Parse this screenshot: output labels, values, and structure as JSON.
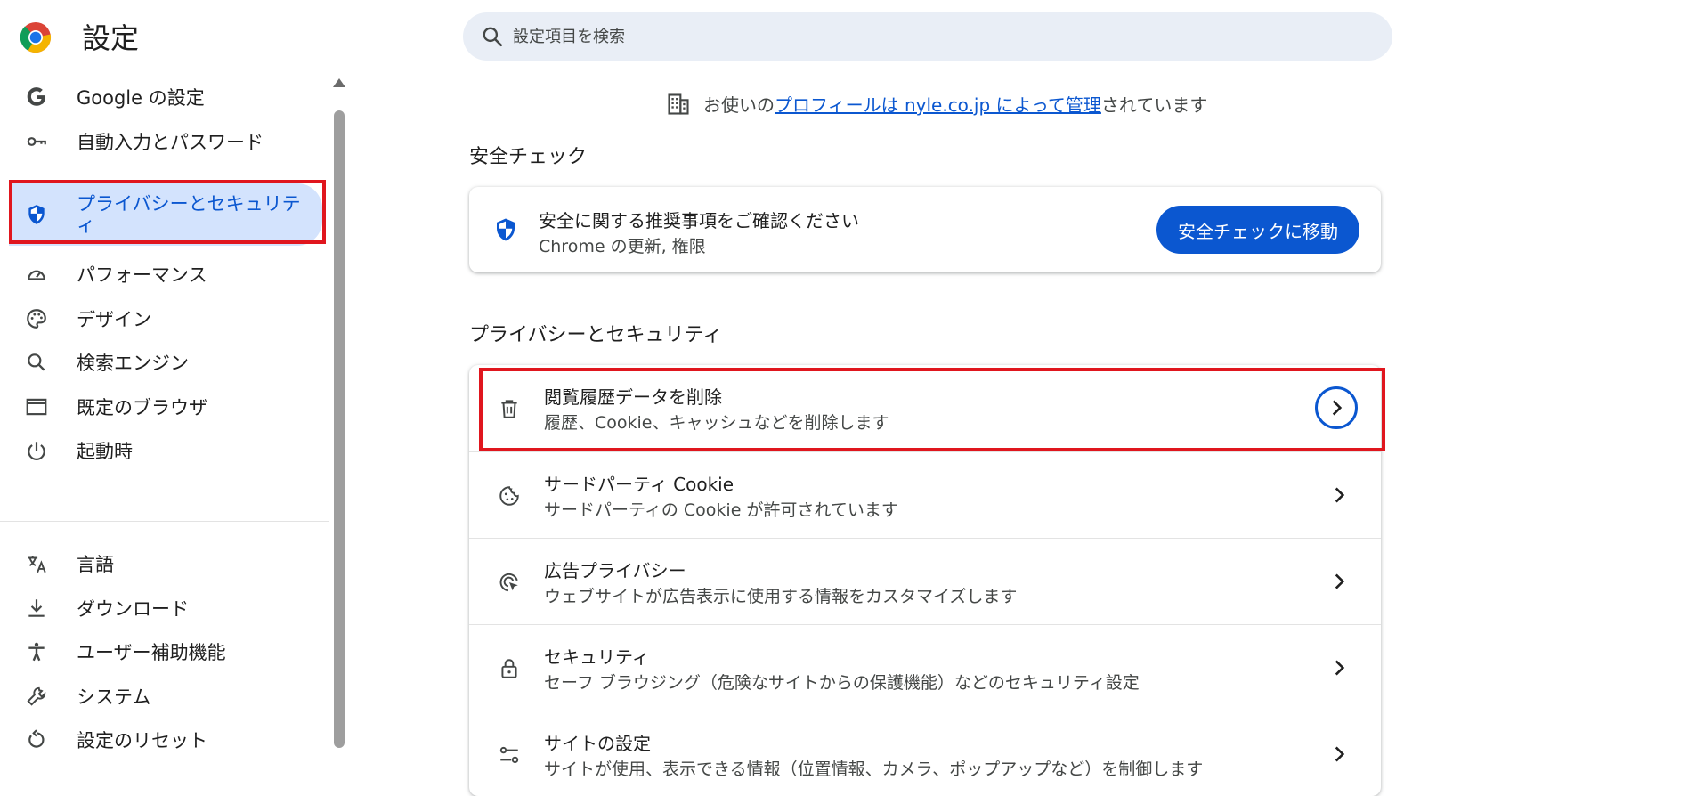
{
  "header": {
    "title": "設定",
    "search_placeholder": "設定項目を検索"
  },
  "sidebar": {
    "items": [
      {
        "label": "Google の設定",
        "icon": "google-g-icon"
      },
      {
        "label": "自動入力とパスワード",
        "icon": "key-icon"
      },
      {
        "label": "プライバシーとセキュリティ",
        "icon": "shield-icon",
        "active": true
      },
      {
        "label": "パフォーマンス",
        "icon": "speedometer-icon"
      },
      {
        "label": "デザイン",
        "icon": "palette-icon"
      },
      {
        "label": "検索エンジン",
        "icon": "search-icon"
      },
      {
        "label": "既定のブラウザ",
        "icon": "browser-window-icon"
      },
      {
        "label": "起動時",
        "icon": "power-icon"
      },
      {
        "label": "言語",
        "icon": "translate-icon"
      },
      {
        "label": "ダウンロード",
        "icon": "download-icon"
      },
      {
        "label": "ユーザー補助機能",
        "icon": "accessibility-icon"
      },
      {
        "label": "システム",
        "icon": "wrench-icon"
      },
      {
        "label": "設定のリセット",
        "icon": "reset-icon"
      }
    ]
  },
  "managed_notice": {
    "prefix": "お使いの",
    "link": "プロフィールは nyle.co.jp によって管理",
    "suffix": "されています"
  },
  "safety_check": {
    "section_title": "安全チェック",
    "title": "安全に関する推奨事項をご確認ください",
    "subtitle": "Chrome の更新, 権限",
    "button": "安全チェックに移動"
  },
  "privacy": {
    "section_title": "プライバシーとセキュリティ",
    "rows": [
      {
        "title": "閲覧履歴データを削除",
        "subtitle": "履歴、Cookie、キャッシュなどを削除します",
        "icon": "trash-icon"
      },
      {
        "title": "サードパーティ Cookie",
        "subtitle": "サードパーティの Cookie が許可されています",
        "icon": "cookie-icon"
      },
      {
        "title": "広告プライバシー",
        "subtitle": "ウェブサイトが広告表示に使用する情報をカスタマイズします",
        "icon": "ad-target-icon"
      },
      {
        "title": "セキュリティ",
        "subtitle": "セーフ ブラウジング（危険なサイトからの保護機能）などのセキュリティ設定",
        "icon": "lock-icon"
      },
      {
        "title": "サイトの設定",
        "subtitle": "サイトが使用、表示できる情報（位置情報、カメラ、ポップアップなど）を制御します",
        "icon": "sliders-icon"
      }
    ]
  },
  "colors": {
    "accent": "#0b57d0",
    "active_bg": "#d3e3fd",
    "highlight": "#e0161e"
  }
}
